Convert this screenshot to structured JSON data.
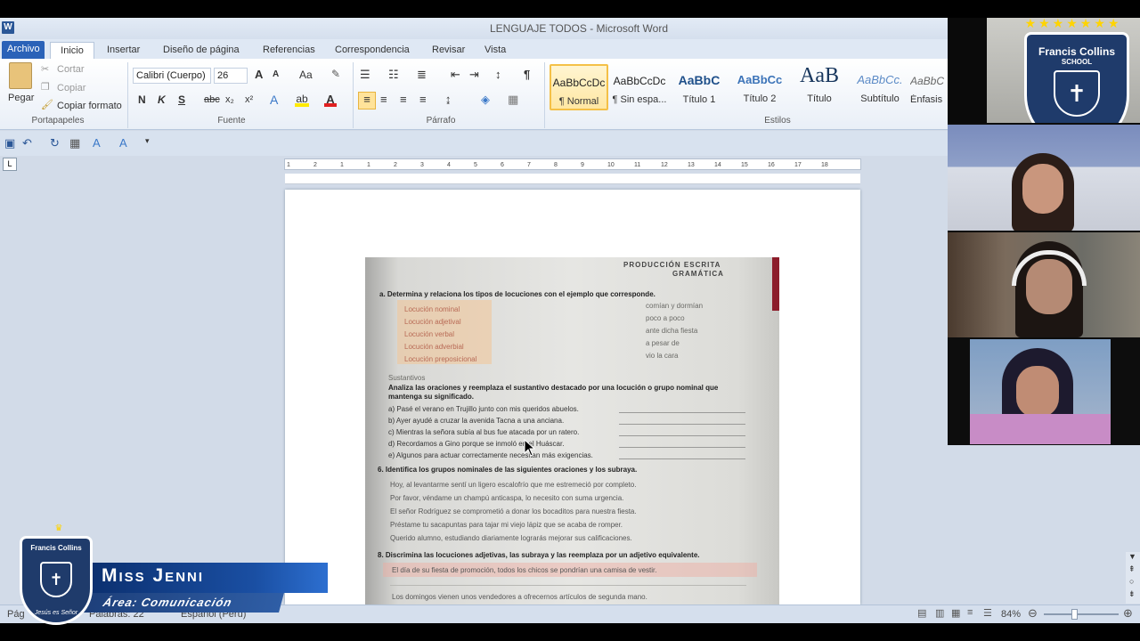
{
  "window": {
    "title": "LENGUAJE TODOS  -  Microsoft Word",
    "app_icon": "W"
  },
  "tabs": [
    "Archivo",
    "Inicio",
    "Insertar",
    "Diseño de página",
    "Referencias",
    "Correspondencia",
    "Revisar",
    "Vista"
  ],
  "clipboard": {
    "paste": "Pegar",
    "cut": "Cortar",
    "copy": "Copiar",
    "format_painter": "Copiar formato",
    "group": "Portapapeles"
  },
  "font": {
    "name": "Calibri (Cuerpo)",
    "size": "26",
    "group": "Fuente",
    "bold": "N",
    "italic": "K",
    "underline": "S",
    "strike": "abc",
    "sub": "x₂",
    "sup": "x²",
    "change_case": "Aa",
    "grow": "A",
    "shrink": "A"
  },
  "paragraph": {
    "group": "Párrafo"
  },
  "styles": {
    "group": "Estilos",
    "items": [
      {
        "preview": "AaBbCcDc",
        "label": "¶ Normal"
      },
      {
        "preview": "AaBbCcDc",
        "label": "¶ Sin espa..."
      },
      {
        "preview": "AaBbC",
        "label": "Título 1"
      },
      {
        "preview": "AaBbCc",
        "label": "Título 2"
      },
      {
        "preview": "AaB",
        "label": "Título"
      },
      {
        "preview": "AaBbCc.",
        "label": "Subtítulo"
      },
      {
        "preview": "AaBbC",
        "label": "Énfasis"
      }
    ]
  },
  "ruler": {
    "marks": [
      "1",
      "2",
      "1",
      "1",
      "2",
      "3",
      "4",
      "5",
      "6",
      "7",
      "8",
      "9",
      "10",
      "11",
      "12",
      "13",
      "14",
      "15",
      "16",
      "17",
      "18"
    ]
  },
  "worksheet": {
    "header": "PRODUCCIÓN ESCRITA",
    "header2": "GRAMÁTICA",
    "q4": "a. Determina y relaciona los tipos de locuciones con el ejemplo que corresponde.",
    "types": [
      "Locución nominal",
      "Locución adjetival",
      "Locución verbal",
      "Locución adverbial",
      "Locución preposicional"
    ],
    "examples": [
      "comían y dormían",
      "poco a poco",
      "ante dicha fiesta",
      "a pesar de",
      "vio la cara"
    ],
    "q5_title": "Sustantivos",
    "q5": "Analiza las oraciones y reemplaza el sustantivo destacado por una locución o grupo nominal que mantenga su significado.",
    "q5_items": [
      "a) Pasé el verano en Trujillo junto con mis queridos abuelos.",
      "b) Ayer ayudé a cruzar la avenida Tacna a una anciana.",
      "c) Mientras la señora subía al bus fue atacada por un ratero.",
      "d) Recordamos a Gino porque se inmoló en el Huáscar.",
      "e) Algunos para actuar correctamente necesitan más exigencias."
    ],
    "q6": "6. Identifica los grupos nominales de las siguientes oraciones y los subraya.",
    "q6_items": [
      "Hoy, al levantarme sentí un ligero escalofrío que me estremeció por completo.",
      "Por favor, véndame un champú anticaspa, lo necesito con suma urgencia.",
      "El señor Rodríguez se comprometió a donar los bocaditos para nuestra fiesta.",
      "Préstame tu sacapuntas para tajar mi viejo lápiz que se acaba de romper.",
      "Querido alumno, estudiando diariamente lograrás mejorar sus calificaciones."
    ],
    "q7": "8. Discrimina las locuciones adjetivas, las subraya y las reemplaza por un adjetivo equivalente.",
    "q7_items": [
      "El día de su fiesta de promoción, todos los chicos se pondrían una camisa de vestir.",
      "Los domingos vienen unos vendedores a ofrecernos artículos de segunda mano."
    ]
  },
  "status": {
    "page": "Pág",
    "words": "Palabras: 22",
    "language": "Español (Perú)",
    "zoom": "84%"
  },
  "overlay": {
    "school": "Francis Collins",
    "school_sub": "SCHOOL",
    "motto": "Jesús es Señor",
    "teacher": "Miss Jenni",
    "area": "Área: Comunicación"
  },
  "colors": {
    "accent": "#2a62b8",
    "banner": "#0b2f6e",
    "crest": "#1f3b6b"
  }
}
